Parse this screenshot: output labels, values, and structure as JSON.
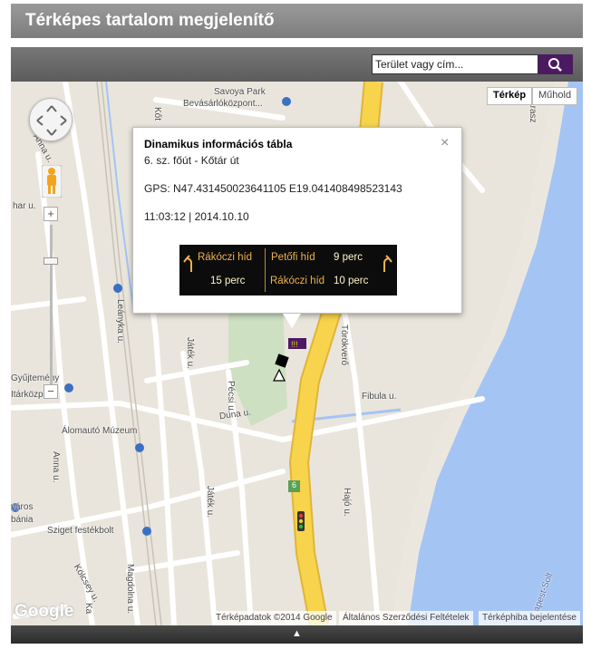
{
  "app": {
    "title": "Térképes tartalom megjelenítő"
  },
  "search": {
    "placeholder": "Terület vagy cím...",
    "value": ""
  },
  "map_type": {
    "options": [
      "Térkép",
      "Műhold"
    ],
    "selected": "Térkép"
  },
  "zoom": {
    "in": "+",
    "out": "−"
  },
  "map_labels": {
    "savoya": "Savoya Park",
    "bevasarlo": "Bevásárlóközpont...",
    "arasz": "Árasz",
    "anna_top": "Anna u.",
    "har_u": "har u.",
    "leanyka": "Leányka u.",
    "jatek_top": "Játék u.",
    "pecsi": "Pécsi u.",
    "torokvero": "Törökverő",
    "fibula": "Fibula u.",
    "gyujtemeny": "Gyűjtemény",
    "tarkozp": "Itárközp",
    "alomauto": "Álomautó Múzeum",
    "duna": "Duna u.",
    "anna_bottom": "Anna u.",
    "jatek_bottom": "Játék u.",
    "hajo": "Hajó u.",
    "varos": "város",
    "bania": "bánia",
    "sziget": "Sziget festékbolt",
    "kolcsey": "Kölcsey u.",
    "magdolna": "Magdolna u.",
    "ka": "Ka",
    "apest_solt": "apest-Solt",
    "kot": "Kőt",
    "route6": "6"
  },
  "popup": {
    "title": "Dinamikus információs tábla",
    "subtitle": "6. sz. főút - Kőtár út",
    "gps": "GPS: N47.431450023641105 E19.041408498523143",
    "time": "11:03:12 | 2014.10.10",
    "close": "×",
    "sign": {
      "left_top": "Rákóczi híd",
      "left_bottom": "15 perc",
      "right_top_name": "Petőfi híd",
      "right_top_time": "9 perc",
      "right_bottom_name": "Rákóczi híd",
      "right_bottom_time": "10 perc"
    }
  },
  "attribution": {
    "data": "Térképadatok ©2014 Google",
    "terms": "Általános Szerződési Feltételek",
    "report": "Térképhiba bejelentése",
    "logo": "Google"
  },
  "footer": {
    "toggle": "▲"
  },
  "colors": {
    "road_major": "#f8d44c",
    "road_outline": "#e0b43a",
    "water": "#a4c4f4",
    "map_bg": "#e9e5dc",
    "park": "#cde0c2",
    "sign_amber": "#f0b24b",
    "search_button": "#4b1a60"
  }
}
